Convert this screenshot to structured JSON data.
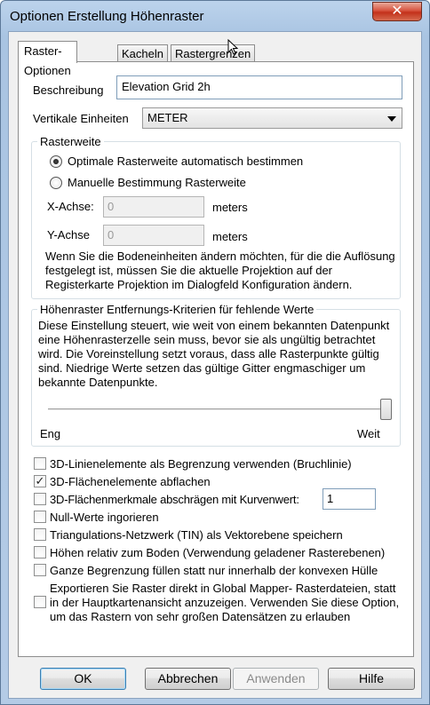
{
  "window": {
    "title": "Optionen Erstellung Höhenraster",
    "close_label": "✕"
  },
  "tabs": [
    {
      "label": "Raster-Optionen",
      "active": true
    },
    {
      "label": "Kacheln",
      "active": false
    },
    {
      "label": "Rastergrenzen",
      "active": false
    }
  ],
  "description": {
    "label": "Beschreibung",
    "value": "Elevation Grid 2h"
  },
  "vertical_units": {
    "label": "Vertikale Einheiten",
    "value": "METER"
  },
  "grid_spacing": {
    "legend": "Rasterweite",
    "option_auto": "Optimale Rasterweite automatisch bestimmen",
    "option_manual": "Manuelle Bestimmung Rasterweite",
    "x_label": "X-Achse:",
    "x_value": "0",
    "x_unit": "meters",
    "y_label": "Y-Achse",
    "y_value": "0",
    "y_unit": "meters",
    "note": "Wenn Sie die Bodeneinheiten ändern möchten, für die die Auflösung festgelegt ist, müssen Sie die aktuelle Projektion auf der Registerkarte Projektion im Dialogfeld Konfiguration ändern."
  },
  "distance": {
    "legend": "Höhenraster Entfernungs-Kriterien für fehlende Werte",
    "text": "Diese Einstellung steuert, wie weit von einem bekannten Datenpunkt eine Höhenrasterzelle sein muss, bevor sie als ungültig betrachtet wird. Die Voreinstellung setzt voraus, dass alle Rasterpunkte gültig sind. Niedrige Werte setzen das gültige Gitter engmaschiger um bekannte Datenpunkte.",
    "min_label": "Eng",
    "max_label": "Weit",
    "slider_fraction": 1.0
  },
  "options": {
    "breaklines": "3D-Linienelemente als Begrenzung verwenden (Bruchlinie)",
    "flatten": "3D-Flächenelemente abflachen",
    "bevel": "3D-Flächenmerkmale abschrägen mit Kurvenwert:",
    "bevel_value": "1",
    "ignore_null": "Null-Werte ingorieren",
    "save_tin": "Triangulations-Netzwerk (TIN) als Vektorebene speichern",
    "heights_relative": "Höhen relativ zum Boden (Verwendung geladener Rasterebenen)",
    "fill_bounds": "Ganze Begrenzung füllen statt nur innerhalb der konvexen Hülle",
    "export_direct": "Exportieren Sie Raster direkt in Global Mapper- Rasterdateien, statt in der Hauptkartenansicht anzuzeigen. Verwenden Sie diese Option, um das Rastern von sehr großen Datensätzen zu erlauben"
  },
  "buttons": {
    "ok": "OK",
    "cancel": "Abbrechen",
    "apply": "Anwenden",
    "help": "Hilfe"
  }
}
